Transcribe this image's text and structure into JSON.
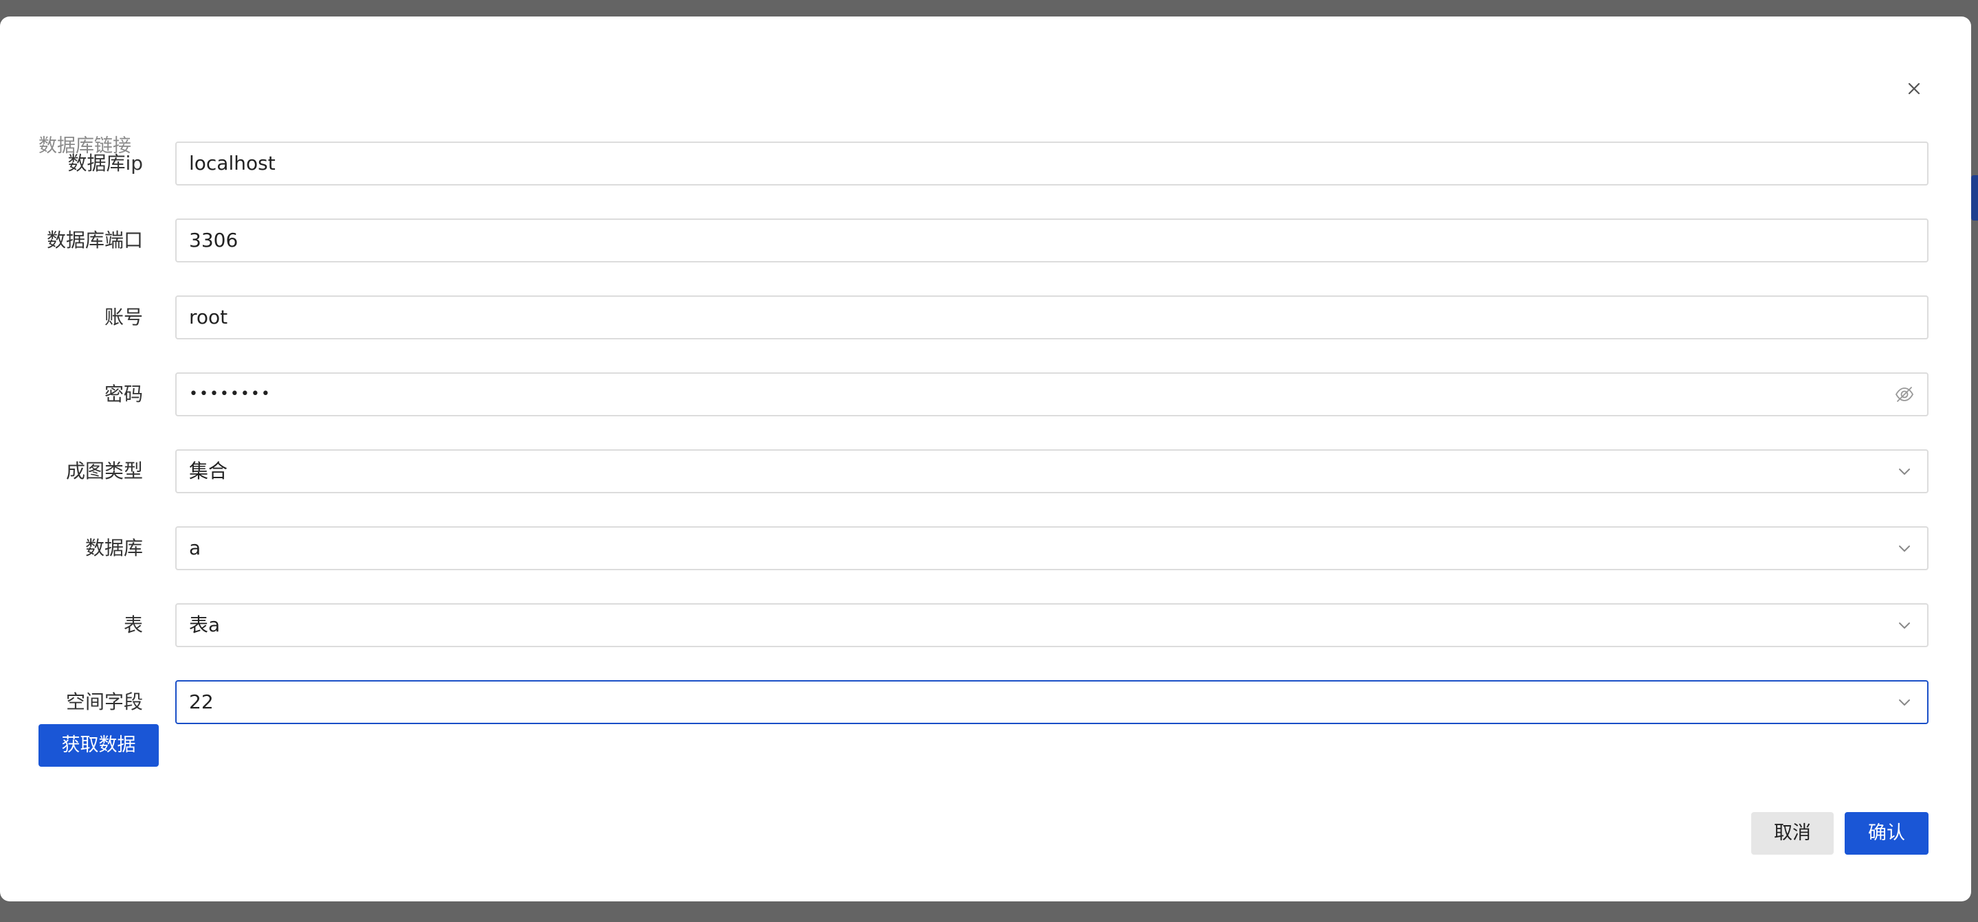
{
  "dialog": {
    "section_title": "数据库链接",
    "fields": [
      {
        "label": "数据库ip",
        "value": "localhost",
        "type": "text"
      },
      {
        "label": "数据库端口",
        "value": "3306",
        "type": "text"
      },
      {
        "label": "账号",
        "value": "root",
        "type": "text"
      },
      {
        "label": "密码",
        "value": "••••••••",
        "type": "password"
      },
      {
        "label": "成图类型",
        "value": "集合",
        "type": "select"
      },
      {
        "label": "数据库",
        "value": "a",
        "type": "select"
      },
      {
        "label": "表",
        "value": "表a",
        "type": "select"
      },
      {
        "label": "空间字段",
        "value": "22",
        "type": "select",
        "focused": true
      }
    ],
    "fetch_button_label": "获取数据",
    "cancel_label": "取消",
    "confirm_label": "确认"
  },
  "icons": {
    "close": "close-icon",
    "password_toggle": "eye-off-icon",
    "select_arrow": "chevron-down-icon"
  },
  "colors": {
    "primary": "#1a56d6",
    "focus_border": "#1a4fc7",
    "overlay": "#646464"
  }
}
